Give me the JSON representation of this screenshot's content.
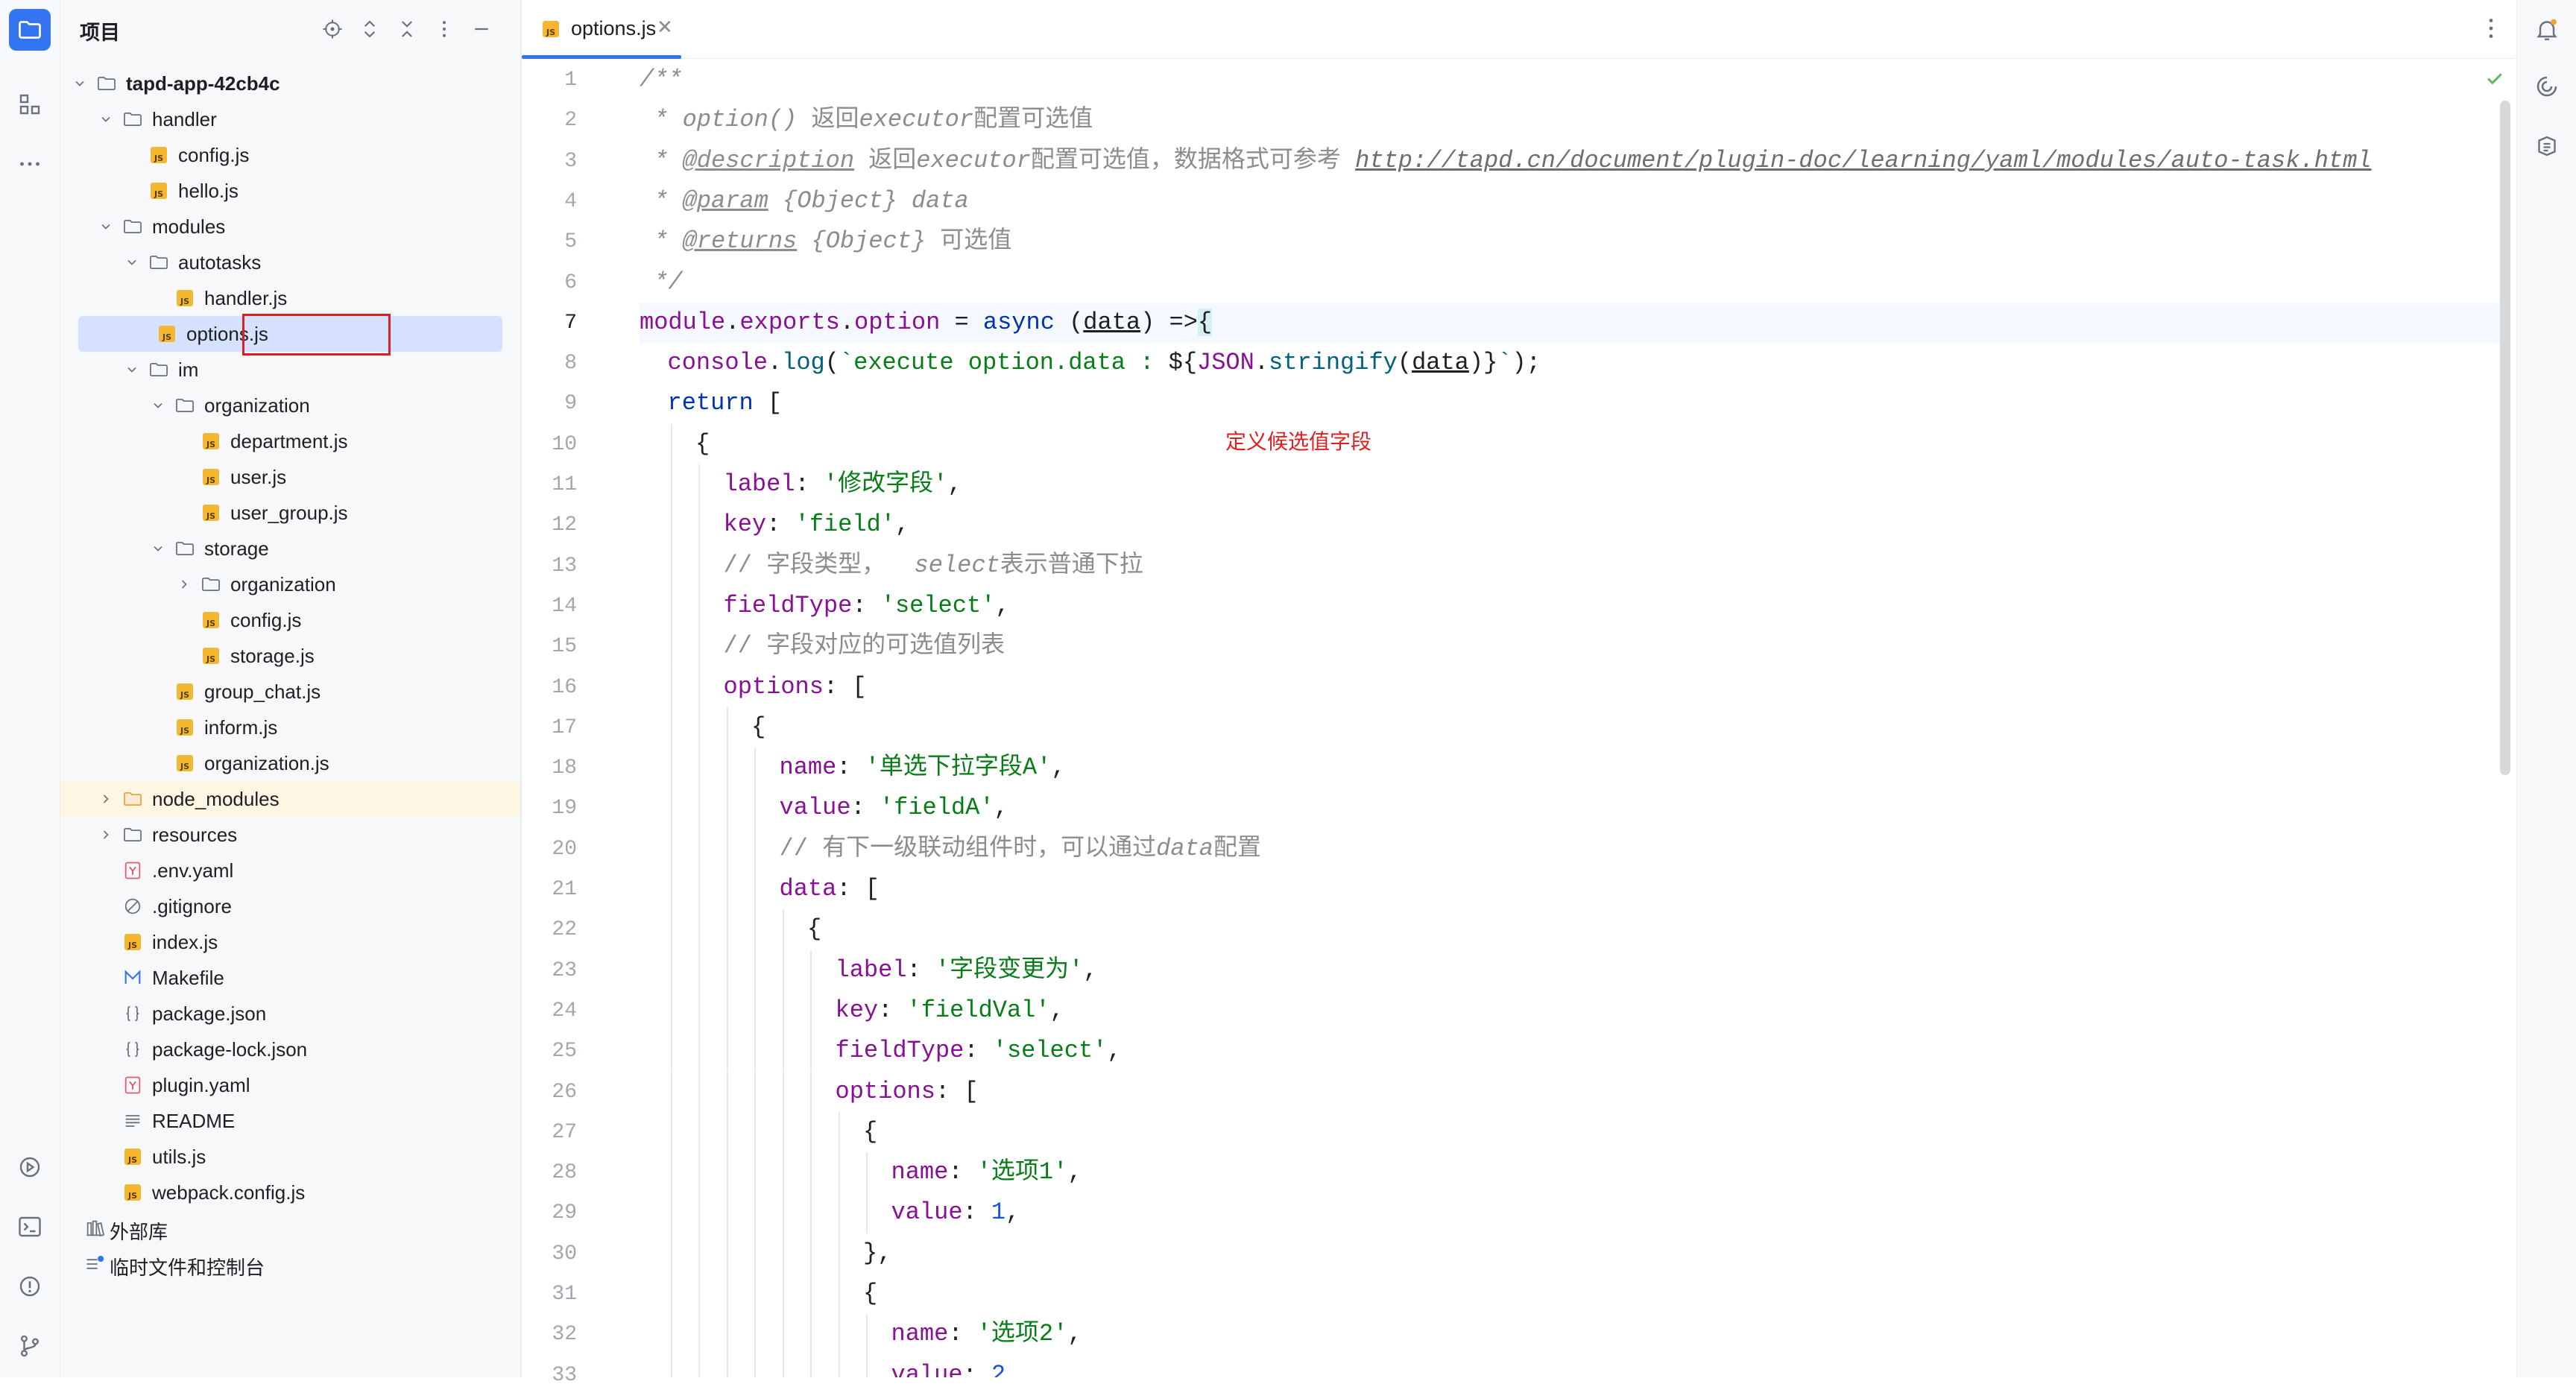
{
  "project_panel": {
    "title": "项目",
    "header_icons": [
      "locate-icon",
      "expand-all-icon",
      "collapse-all-icon",
      "more-icon",
      "hide-icon"
    ]
  },
  "tree": [
    {
      "level": 0,
      "kind": "folder",
      "name": "tapd-app-42cb4c",
      "expanded": true,
      "bold": true
    },
    {
      "level": 1,
      "kind": "folder",
      "name": "handler",
      "expanded": true
    },
    {
      "level": 2,
      "kind": "js",
      "name": "config.js"
    },
    {
      "level": 2,
      "kind": "js",
      "name": "hello.js"
    },
    {
      "level": 1,
      "kind": "folder",
      "name": "modules",
      "expanded": true
    },
    {
      "level": 2,
      "kind": "folder",
      "name": "autotasks",
      "expanded": true
    },
    {
      "level": 3,
      "kind": "js",
      "name": "handler.js"
    },
    {
      "level": 3,
      "kind": "js",
      "name": "options.js",
      "selected": true
    },
    {
      "level": 2,
      "kind": "folder",
      "name": "im",
      "expanded": true
    },
    {
      "level": 3,
      "kind": "folder",
      "name": "organization",
      "expanded": true
    },
    {
      "level": 4,
      "kind": "js",
      "name": "department.js"
    },
    {
      "level": 4,
      "kind": "js",
      "name": "user.js"
    },
    {
      "level": 4,
      "kind": "js",
      "name": "user_group.js"
    },
    {
      "level": 3,
      "kind": "folder",
      "name": "storage",
      "expanded": true
    },
    {
      "level": 4,
      "kind": "folder",
      "name": "organization",
      "expanded": false
    },
    {
      "level": 4,
      "kind": "js",
      "name": "config.js"
    },
    {
      "level": 4,
      "kind": "js",
      "name": "storage.js"
    },
    {
      "level": 3,
      "kind": "js",
      "name": "group_chat.js"
    },
    {
      "level": 3,
      "kind": "js",
      "name": "inform.js"
    },
    {
      "level": 3,
      "kind": "js",
      "name": "organization.js"
    },
    {
      "level": 1,
      "kind": "folder-excluded",
      "name": "node_modules",
      "expanded": false,
      "highlight": true
    },
    {
      "level": 1,
      "kind": "folder",
      "name": "resources",
      "expanded": false
    },
    {
      "level": 1,
      "kind": "yaml",
      "name": ".env.yaml"
    },
    {
      "level": 1,
      "kind": "ignore",
      "name": ".gitignore"
    },
    {
      "level": 1,
      "kind": "js",
      "name": "index.js"
    },
    {
      "level": 1,
      "kind": "makefile",
      "name": "Makefile"
    },
    {
      "level": 1,
      "kind": "json",
      "name": "package.json"
    },
    {
      "level": 1,
      "kind": "json",
      "name": "package-lock.json"
    },
    {
      "level": 1,
      "kind": "yaml",
      "name": "plugin.yaml"
    },
    {
      "level": 1,
      "kind": "text",
      "name": "README"
    },
    {
      "level": 1,
      "kind": "js",
      "name": "utils.js"
    },
    {
      "level": 1,
      "kind": "js",
      "name": "webpack.config.js"
    },
    {
      "level": 0,
      "kind": "library",
      "name": "外部库"
    },
    {
      "level": 0,
      "kind": "scratch",
      "name": "临时文件和控制台"
    }
  ],
  "editor": {
    "tab_label": "options.js",
    "tab_badge": "JS",
    "annotation": "定义候选值字段",
    "current_line": 7,
    "lines": [
      {
        "n": 1,
        "indent": 0,
        "tokens": [
          [
            "cm",
            "/**"
          ]
        ]
      },
      {
        "n": 2,
        "indent": 0,
        "tokens": [
          [
            "cm",
            " * option() "
          ],
          [
            "cm-plain",
            "返回"
          ],
          [
            "cm",
            "executor"
          ],
          [
            "cm-plain",
            "配置可选值"
          ]
        ]
      },
      {
        "n": 3,
        "indent": 0,
        "tokens": [
          [
            "cm",
            " * "
          ],
          [
            "tag",
            "@description"
          ],
          [
            "cm",
            " "
          ],
          [
            "cm-plain",
            "返回"
          ],
          [
            "cm",
            "executor"
          ],
          [
            "cm-plain",
            "配置可选值，数据格式可参考 "
          ],
          [
            "link",
            "http://tapd.cn/document/plugin-doc/learning/yaml/modules/auto-task.html"
          ]
        ]
      },
      {
        "n": 4,
        "indent": 0,
        "tokens": [
          [
            "cm",
            " * "
          ],
          [
            "tag",
            "@param"
          ],
          [
            "cm",
            " {Object} data"
          ]
        ]
      },
      {
        "n": 5,
        "indent": 0,
        "tokens": [
          [
            "cm",
            " * "
          ],
          [
            "tag",
            "@returns"
          ],
          [
            "cm",
            " {Object} "
          ],
          [
            "cm-plain",
            "可选值"
          ]
        ]
      },
      {
        "n": 6,
        "indent": 0,
        "tokens": [
          [
            "cm",
            " */"
          ]
        ]
      },
      {
        "n": 7,
        "indent": 0,
        "tokens": [
          [
            "prop",
            "module"
          ],
          [
            "",
            "."
          ],
          [
            "prop",
            "exports"
          ],
          [
            "",
            "."
          ],
          [
            "prop",
            "option"
          ],
          [
            "",
            " = "
          ],
          [
            "kw",
            "async"
          ],
          [
            "",
            " ("
          ],
          [
            "param",
            "data"
          ],
          [
            "",
            ") =>"
          ],
          [
            "brace-hl",
            "{"
          ]
        ]
      },
      {
        "n": 8,
        "indent": 1,
        "tokens": [
          [
            "prop",
            "console"
          ],
          [
            "",
            "."
          ],
          [
            "fn",
            "log"
          ],
          [
            "",
            "("
          ],
          [
            "str",
            "`execute option.data : "
          ],
          [
            "",
            "${"
          ],
          [
            "prop",
            "JSON"
          ],
          [
            "",
            "."
          ],
          [
            "fn",
            "stringify"
          ],
          [
            "",
            "("
          ],
          [
            "param",
            "data"
          ],
          [
            "",
            ")}"
          ],
          [
            "str",
            "`"
          ],
          [
            "",
            ");"
          ]
        ]
      },
      {
        "n": 9,
        "indent": 1,
        "tokens": [
          [
            "kw",
            "return"
          ],
          [
            "",
            " ["
          ]
        ]
      },
      {
        "n": 10,
        "indent": 2,
        "tokens": [
          [
            "",
            "{"
          ]
        ]
      },
      {
        "n": 11,
        "indent": 3,
        "tokens": [
          [
            "prop",
            "label"
          ],
          [
            "",
            ": "
          ],
          [
            "str",
            "'修改字段'"
          ],
          [
            "",
            ","
          ]
        ]
      },
      {
        "n": 12,
        "indent": 3,
        "tokens": [
          [
            "prop",
            "key"
          ],
          [
            "",
            ": "
          ],
          [
            "str",
            "'field'"
          ],
          [
            "",
            ","
          ]
        ]
      },
      {
        "n": 13,
        "indent": 3,
        "tokens": [
          [
            "cm-plain",
            "// 字段类型，  "
          ],
          [
            "cm",
            "select"
          ],
          [
            "cm-plain",
            "表示普通下拉"
          ]
        ]
      },
      {
        "n": 14,
        "indent": 3,
        "tokens": [
          [
            "prop",
            "fieldType"
          ],
          [
            "",
            ": "
          ],
          [
            "str",
            "'select'"
          ],
          [
            "",
            ","
          ]
        ]
      },
      {
        "n": 15,
        "indent": 3,
        "tokens": [
          [
            "cm-plain",
            "// 字段对应的可选值列表"
          ]
        ]
      },
      {
        "n": 16,
        "indent": 3,
        "tokens": [
          [
            "prop",
            "options"
          ],
          [
            "",
            ": ["
          ]
        ]
      },
      {
        "n": 17,
        "indent": 4,
        "tokens": [
          [
            "",
            "{"
          ]
        ]
      },
      {
        "n": 18,
        "indent": 5,
        "tokens": [
          [
            "prop",
            "name"
          ],
          [
            "",
            ": "
          ],
          [
            "str",
            "'单选下拉字段A'"
          ],
          [
            "",
            ","
          ]
        ]
      },
      {
        "n": 19,
        "indent": 5,
        "tokens": [
          [
            "prop",
            "value"
          ],
          [
            "",
            ": "
          ],
          [
            "str",
            "'fieldA'"
          ],
          [
            "",
            ","
          ]
        ]
      },
      {
        "n": 20,
        "indent": 5,
        "tokens": [
          [
            "cm-plain",
            "// 有下一级联动组件时，可以通过"
          ],
          [
            "cm",
            "data"
          ],
          [
            "cm-plain",
            "配置"
          ]
        ]
      },
      {
        "n": 21,
        "indent": 5,
        "tokens": [
          [
            "prop",
            "data"
          ],
          [
            "",
            ": ["
          ]
        ]
      },
      {
        "n": 22,
        "indent": 6,
        "tokens": [
          [
            "",
            "{"
          ]
        ]
      },
      {
        "n": 23,
        "indent": 7,
        "tokens": [
          [
            "prop",
            "label"
          ],
          [
            "",
            ": "
          ],
          [
            "str",
            "'字段变更为'"
          ],
          [
            "",
            ","
          ]
        ]
      },
      {
        "n": 24,
        "indent": 7,
        "tokens": [
          [
            "prop",
            "key"
          ],
          [
            "",
            ": "
          ],
          [
            "str",
            "'fieldVal'"
          ],
          [
            "",
            ","
          ]
        ]
      },
      {
        "n": 25,
        "indent": 7,
        "tokens": [
          [
            "prop",
            "fieldType"
          ],
          [
            "",
            ": "
          ],
          [
            "str",
            "'select'"
          ],
          [
            "",
            ","
          ]
        ]
      },
      {
        "n": 26,
        "indent": 7,
        "tokens": [
          [
            "prop",
            "options"
          ],
          [
            "",
            ": ["
          ]
        ]
      },
      {
        "n": 27,
        "indent": 8,
        "tokens": [
          [
            "",
            "{"
          ]
        ]
      },
      {
        "n": 28,
        "indent": 9,
        "tokens": [
          [
            "prop",
            "name"
          ],
          [
            "",
            ": "
          ],
          [
            "str",
            "'选项1'"
          ],
          [
            "",
            ","
          ]
        ]
      },
      {
        "n": 29,
        "indent": 9,
        "tokens": [
          [
            "prop",
            "value"
          ],
          [
            "",
            ": "
          ],
          [
            "num",
            "1"
          ],
          [
            "",
            ","
          ]
        ]
      },
      {
        "n": 30,
        "indent": 8,
        "tokens": [
          [
            "",
            "},"
          ]
        ]
      },
      {
        "n": 31,
        "indent": 8,
        "tokens": [
          [
            "",
            "{"
          ]
        ]
      },
      {
        "n": 32,
        "indent": 9,
        "tokens": [
          [
            "prop",
            "name"
          ],
          [
            "",
            ": "
          ],
          [
            "str",
            "'选项2'"
          ],
          [
            "",
            ","
          ]
        ]
      },
      {
        "n": 33,
        "indent": 9,
        "tokens": [
          [
            "prop",
            "value"
          ],
          [
            "",
            ": "
          ],
          [
            "num",
            "2"
          ],
          [
            "",
            ","
          ]
        ]
      }
    ]
  },
  "toolstrip_icons": [
    "project-icon",
    "structure-icon",
    "more-tools-icon",
    "services-icon",
    "terminal-icon",
    "problems-icon",
    "git-icon"
  ],
  "rightstrip_icons": [
    "notifications-icon",
    "ai-assistant-icon",
    "copilot-icon"
  ],
  "colors": {
    "accent": "#3574f0",
    "annotation": "#e02020",
    "selection": "#d5e1ff"
  }
}
